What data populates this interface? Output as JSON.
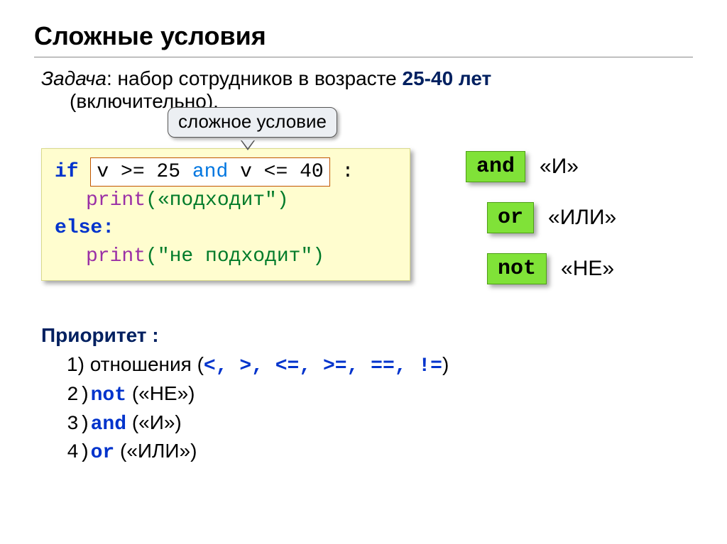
{
  "title": "Сложные условия",
  "task": {
    "label": "Задача",
    "text1": ": набор сотрудников в возрасте ",
    "bold": "25-40 лет",
    "text2": "(включительно)."
  },
  "callout": "сложное условие",
  "code": {
    "if_kw": "if",
    "cond_pre": "v >= 25 ",
    "cond_and": "and",
    "cond_post": " v <= 40",
    "cond_tail": " :",
    "print_kw": "print",
    "print1_arg": "(«подходит\")",
    "else_kw": "else:",
    "print2_arg": "(\"не подходит\")"
  },
  "operators": [
    {
      "kw": "and",
      "label": "«И»"
    },
    {
      "kw": "or",
      "label": "«ИЛИ»"
    },
    {
      "kw": "not",
      "label": "«НЕ»"
    }
  ],
  "priority": {
    "title": "Приоритет :",
    "p1_num": "1) ",
    "p1_text": "отношения (",
    "p1_ops": "<, >, <=, >=, ==, !=",
    "p1_close": ")",
    "p2_num": "2)",
    "p2_kw": "not",
    "p2_label": "(«НЕ»)",
    "p3_num": "3)",
    "p3_kw": "and",
    "p3_label": "(«И»)",
    "p4_num": "4)",
    "p4_kw": "or",
    "p4_label": "(«ИЛИ»)"
  }
}
